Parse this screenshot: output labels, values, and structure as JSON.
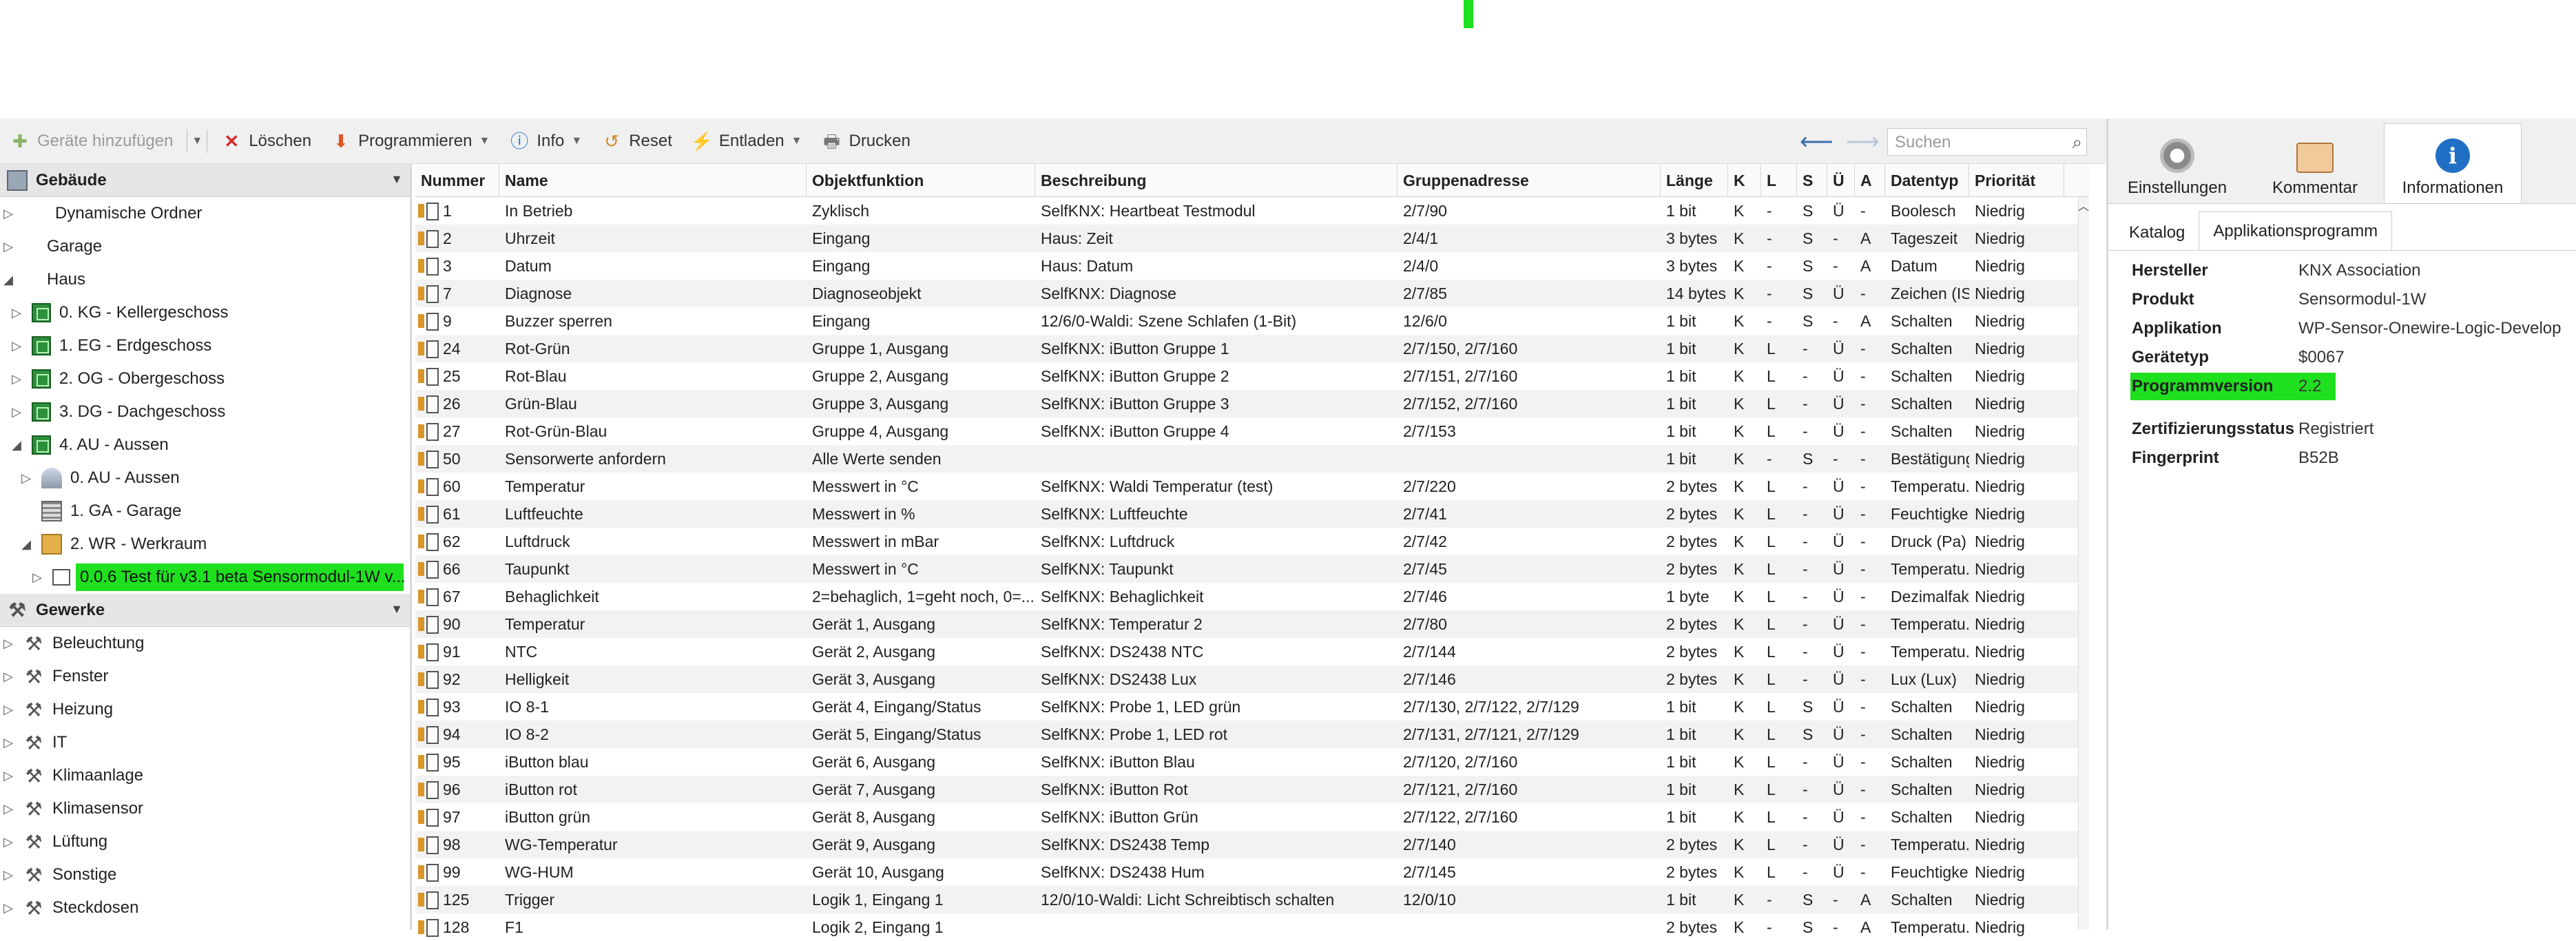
{
  "toolbar": {
    "add_devices": "Geräte hinzufügen",
    "delete": "Löschen",
    "program": "Programmieren",
    "info": "Info",
    "reset": "Reset",
    "unload": "Entladen",
    "print": "Drucken",
    "search_placeholder": "Suchen"
  },
  "sidebar": {
    "buildings_header": "Gebäude",
    "trades_header": "Gewerke",
    "buildings": [
      {
        "label": "Dynamische Ordner"
      },
      {
        "label": "Garage"
      },
      {
        "label": "Haus"
      },
      {
        "label": "0. KG - Kellergeschoss"
      },
      {
        "label": "1. EG - Erdgeschoss"
      },
      {
        "label": "2. OG - Obergeschoss"
      },
      {
        "label": "3. DG - Dachgeschoss"
      },
      {
        "label": "4. AU - Aussen"
      },
      {
        "label": "0. AU - Aussen"
      },
      {
        "label": "1. GA - Garage"
      },
      {
        "label": "2. WR - Werkraum"
      },
      {
        "label": "0.0.6 Test für v3.1 beta Sensormodul-1W v..."
      }
    ],
    "trades": [
      {
        "label": "Beleuchtung"
      },
      {
        "label": "Fenster"
      },
      {
        "label": "Heizung"
      },
      {
        "label": "IT"
      },
      {
        "label": "Klimaanlage"
      },
      {
        "label": "Klimasensor"
      },
      {
        "label": "Lüftung"
      },
      {
        "label": "Sonstige"
      },
      {
        "label": "Steckdosen"
      }
    ]
  },
  "table": {
    "columns": [
      "Nummer",
      "Name",
      "Objektfunktion",
      "Beschreibung",
      "Gruppenadresse",
      "Länge",
      "K",
      "L",
      "S",
      "Ü",
      "A",
      "Datentyp",
      "Priorität"
    ],
    "rows": [
      [
        "1",
        "In Betrieb",
        "Zyklisch",
        "SelfKNX: Heartbeat Testmodul",
        "2/7/90",
        "1 bit",
        "K",
        "-",
        "S",
        "Ü",
        "-",
        "Boolesch",
        "Niedrig"
      ],
      [
        "2",
        "Uhrzeit",
        "Eingang",
        "Haus: Zeit",
        "2/4/1",
        "3 bytes",
        "K",
        "-",
        "S",
        "-",
        "A",
        "Tageszeit",
        "Niedrig"
      ],
      [
        "3",
        "Datum",
        "Eingang",
        "Haus: Datum",
        "2/4/0",
        "3 bytes",
        "K",
        "-",
        "S",
        "-",
        "A",
        "Datum",
        "Niedrig"
      ],
      [
        "7",
        "Diagnose",
        "Diagnoseobjekt",
        "SelfKNX: Diagnose",
        "2/7/85",
        "14 bytes",
        "K",
        "-",
        "S",
        "Ü",
        "-",
        "Zeichen (IS...",
        "Niedrig"
      ],
      [
        "9",
        "Buzzer sperren",
        "Eingang",
        "12/6/0-Waldi: Szene Schlafen (1-Bit)",
        "12/6/0",
        "1 bit",
        "K",
        "-",
        "S",
        "-",
        "A",
        "Schalten",
        "Niedrig"
      ],
      [
        "24",
        "Rot-Grün",
        "Gruppe 1, Ausgang",
        "SelfKNX: iButton Gruppe 1",
        "2/7/150, 2/7/160",
        "1 bit",
        "K",
        "L",
        "-",
        "Ü",
        "-",
        "Schalten",
        "Niedrig"
      ],
      [
        "25",
        "Rot-Blau",
        "Gruppe 2, Ausgang",
        "SelfKNX: iButton Gruppe 2",
        "2/7/151, 2/7/160",
        "1 bit",
        "K",
        "L",
        "-",
        "Ü",
        "-",
        "Schalten",
        "Niedrig"
      ],
      [
        "26",
        "Grün-Blau",
        "Gruppe 3, Ausgang",
        "SelfKNX: iButton Gruppe 3",
        "2/7/152, 2/7/160",
        "1 bit",
        "K",
        "L",
        "-",
        "Ü",
        "-",
        "Schalten",
        "Niedrig"
      ],
      [
        "27",
        "Rot-Grün-Blau",
        "Gruppe 4, Ausgang",
        "SelfKNX: iButton Gruppe 4",
        "2/7/153",
        "1 bit",
        "K",
        "L",
        "-",
        "Ü",
        "-",
        "Schalten",
        "Niedrig"
      ],
      [
        "50",
        "Sensorwerte anfordern",
        "Alle Werte senden",
        "",
        "",
        "1 bit",
        "K",
        "-",
        "S",
        "-",
        "-",
        "Bestätigung",
        "Niedrig"
      ],
      [
        "60",
        "Temperatur",
        "Messwert in °C",
        "SelfKNX: Waldi Temperatur (test)",
        "2/7/220",
        "2 bytes",
        "K",
        "L",
        "-",
        "Ü",
        "-",
        "Temperatu...",
        "Niedrig"
      ],
      [
        "61",
        "Luftfeuchte",
        "Messwert in %",
        "SelfKNX: Luftfeuchte",
        "2/7/41",
        "2 bytes",
        "K",
        "L",
        "-",
        "Ü",
        "-",
        "Feuchtigke...",
        "Niedrig"
      ],
      [
        "62",
        "Luftdruck",
        "Messwert in mBar",
        "SelfKNX: Luftdruck",
        "2/7/42",
        "2 bytes",
        "K",
        "L",
        "-",
        "Ü",
        "-",
        "Druck (Pa)",
        "Niedrig"
      ],
      [
        "66",
        "Taupunkt",
        "Messwert in °C",
        "SelfKNX: Taupunkt",
        "2/7/45",
        "2 bytes",
        "K",
        "L",
        "-",
        "Ü",
        "-",
        "Temperatu...",
        "Niedrig"
      ],
      [
        "67",
        "Behaglichkeit",
        "2=behaglich, 1=geht noch, 0=...",
        "SelfKNX: Behaglichkeit",
        "2/7/46",
        "1 byte",
        "K",
        "L",
        "-",
        "Ü",
        "-",
        "Dezimalfak...",
        "Niedrig"
      ],
      [
        "90",
        "Temperatur",
        "Gerät 1, Ausgang",
        "SelfKNX: Temperatur 2",
        "2/7/80",
        "2 bytes",
        "K",
        "L",
        "-",
        "Ü",
        "-",
        "Temperatu...",
        "Niedrig"
      ],
      [
        "91",
        "NTC",
        "Gerät 2, Ausgang",
        "SelfKNX: DS2438 NTC",
        "2/7/144",
        "2 bytes",
        "K",
        "L",
        "-",
        "Ü",
        "-",
        "Temperatu...",
        "Niedrig"
      ],
      [
        "92",
        "Helligkeit",
        "Gerät 3, Ausgang",
        "SelfKNX: DS2438 Lux",
        "2/7/146",
        "2 bytes",
        "K",
        "L",
        "-",
        "Ü",
        "-",
        "Lux (Lux)",
        "Niedrig"
      ],
      [
        "93",
        "IO 8-1",
        "Gerät 4, Eingang/Status",
        "SelfKNX: Probe 1, LED grün",
        "2/7/130, 2/7/122, 2/7/129",
        "1 bit",
        "K",
        "L",
        "S",
        "Ü",
        "-",
        "Schalten",
        "Niedrig"
      ],
      [
        "94",
        "IO 8-2",
        "Gerät 5, Eingang/Status",
        "SelfKNX: Probe 1, LED rot",
        "2/7/131, 2/7/121, 2/7/129",
        "1 bit",
        "K",
        "L",
        "S",
        "Ü",
        "-",
        "Schalten",
        "Niedrig"
      ],
      [
        "95",
        "iButton blau",
        "Gerät 6, Ausgang",
        "SelfKNX: iButton Blau",
        "2/7/120, 2/7/160",
        "1 bit",
        "K",
        "L",
        "-",
        "Ü",
        "-",
        "Schalten",
        "Niedrig"
      ],
      [
        "96",
        "iButton rot",
        "Gerät 7, Ausgang",
        "SelfKNX: iButton Rot",
        "2/7/121, 2/7/160",
        "1 bit",
        "K",
        "L",
        "-",
        "Ü",
        "-",
        "Schalten",
        "Niedrig"
      ],
      [
        "97",
        "iButton grün",
        "Gerät 8, Ausgang",
        "SelfKNX: iButton Grün",
        "2/7/122, 2/7/160",
        "1 bit",
        "K",
        "L",
        "-",
        "Ü",
        "-",
        "Schalten",
        "Niedrig"
      ],
      [
        "98",
        "WG-Temperatur",
        "Gerät 9, Ausgang",
        "SelfKNX: DS2438 Temp",
        "2/7/140",
        "2 bytes",
        "K",
        "L",
        "-",
        "Ü",
        "-",
        "Temperatu...",
        "Niedrig"
      ],
      [
        "99",
        "WG-HUM",
        "Gerät 10, Ausgang",
        "SelfKNX: DS2438 Hum",
        "2/7/145",
        "2 bytes",
        "K",
        "L",
        "-",
        "Ü",
        "-",
        "Feuchtigke...",
        "Niedrig"
      ],
      [
        "125",
        "Trigger",
        "Logik 1, Eingang 1",
        "12/0/10-Waldi: Licht Schreibtisch schalten",
        "12/0/10",
        "1 bit",
        "K",
        "-",
        "S",
        "-",
        "A",
        "Schalten",
        "Niedrig"
      ],
      [
        "128",
        "F1",
        "Logik 2, Eingang 1",
        "",
        "",
        "2 bytes",
        "K",
        "-",
        "S",
        "-",
        "A",
        "Temperatu...",
        "Niedrig"
      ]
    ]
  },
  "right_panel": {
    "tabs": [
      "Einstellungen",
      "Kommentar",
      "Informationen"
    ],
    "subtabs": [
      "Katalog",
      "Applikationsprogramm"
    ],
    "properties": [
      {
        "key": "Hersteller",
        "value": "KNX Association"
      },
      {
        "key": "Produkt",
        "value": "Sensormodul-1W"
      },
      {
        "key": "Applikation",
        "value": "WP-Sensor-Onewire-Logic-Develop"
      },
      {
        "key": "Gerätetyp",
        "value": "$0067"
      },
      {
        "key": "Programmversion",
        "value": "2.2"
      },
      {
        "key": "Zertifizierungsstatus",
        "value": "Registriert"
      },
      {
        "key": "Fingerprint",
        "value": "B52B"
      }
    ]
  },
  "colors": {
    "highlight": "#1ee01e",
    "accent_blue": "#1f6fc5"
  }
}
